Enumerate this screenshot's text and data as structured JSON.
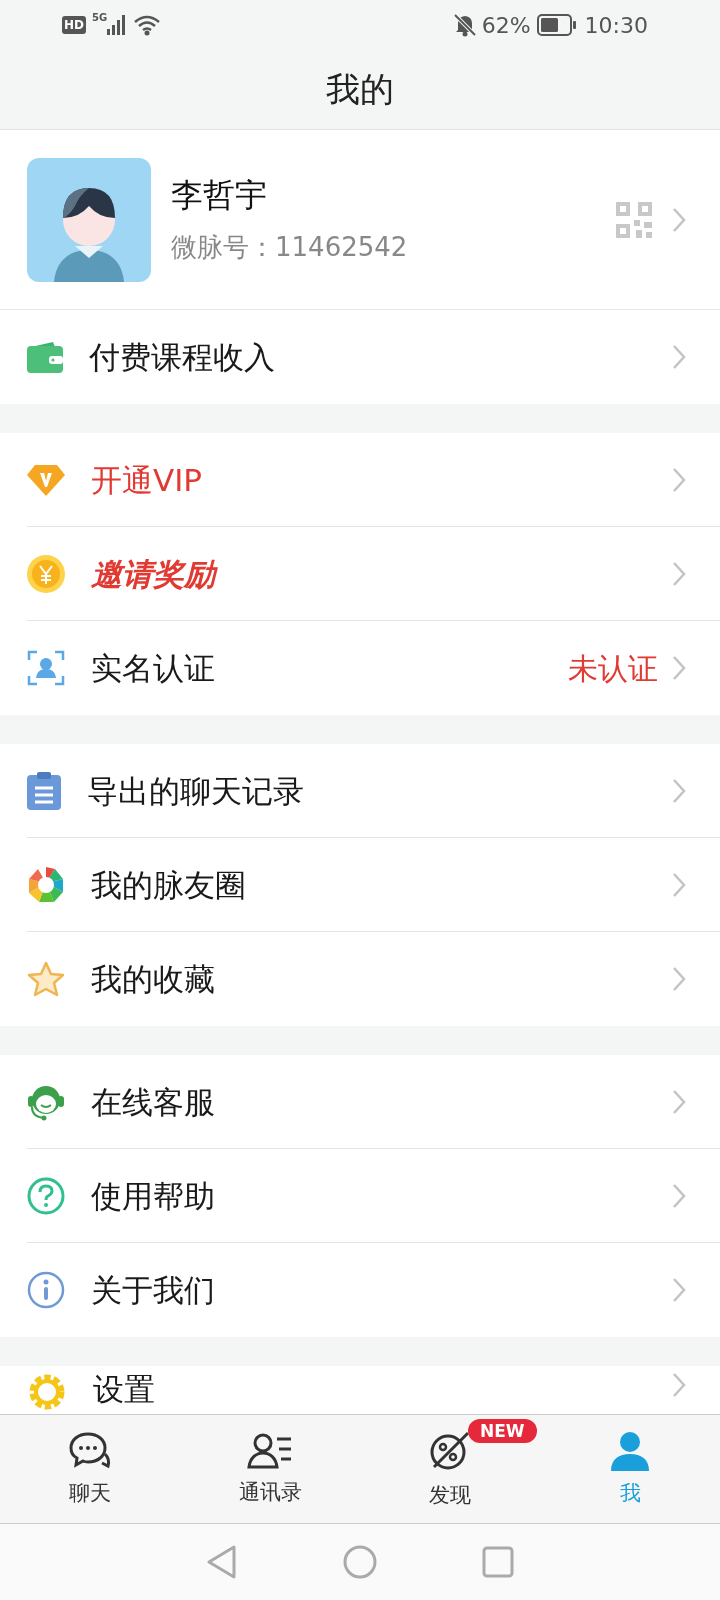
{
  "status_bar": {
    "hd": "HD",
    "network": "5G",
    "battery": "62%",
    "time": "10:30"
  },
  "header": {
    "title": "我的"
  },
  "profile": {
    "name": "李哲宇",
    "id_label": "微脉号：11462542"
  },
  "sections": [
    {
      "items": [
        {
          "label": "付费课程收入",
          "kind": "plain"
        }
      ]
    },
    {
      "items": [
        {
          "label": "开通VIP",
          "kind": "highlight"
        },
        {
          "label": "邀请奖励",
          "kind": "promo"
        },
        {
          "label": "实名认证",
          "kind": "plain",
          "value": "未认证"
        }
      ]
    },
    {
      "items": [
        {
          "label": "导出的聊天记录",
          "kind": "plain"
        },
        {
          "label": "我的脉友圈",
          "kind": "plain"
        },
        {
          "label": "我的收藏",
          "kind": "plain"
        }
      ]
    },
    {
      "items": [
        {
          "label": "在线客服",
          "kind": "plain"
        },
        {
          "label": "使用帮助",
          "kind": "plain"
        },
        {
          "label": "关于我们",
          "kind": "plain"
        }
      ]
    },
    {
      "items": [
        {
          "label": "设置",
          "kind": "plain"
        }
      ]
    }
  ],
  "tabs": [
    {
      "label": "聊天",
      "selected": false
    },
    {
      "label": "通讯录",
      "selected": false
    },
    {
      "label": "发现",
      "selected": false,
      "badge": "NEW"
    },
    {
      "label": "我",
      "selected": true
    }
  ]
}
